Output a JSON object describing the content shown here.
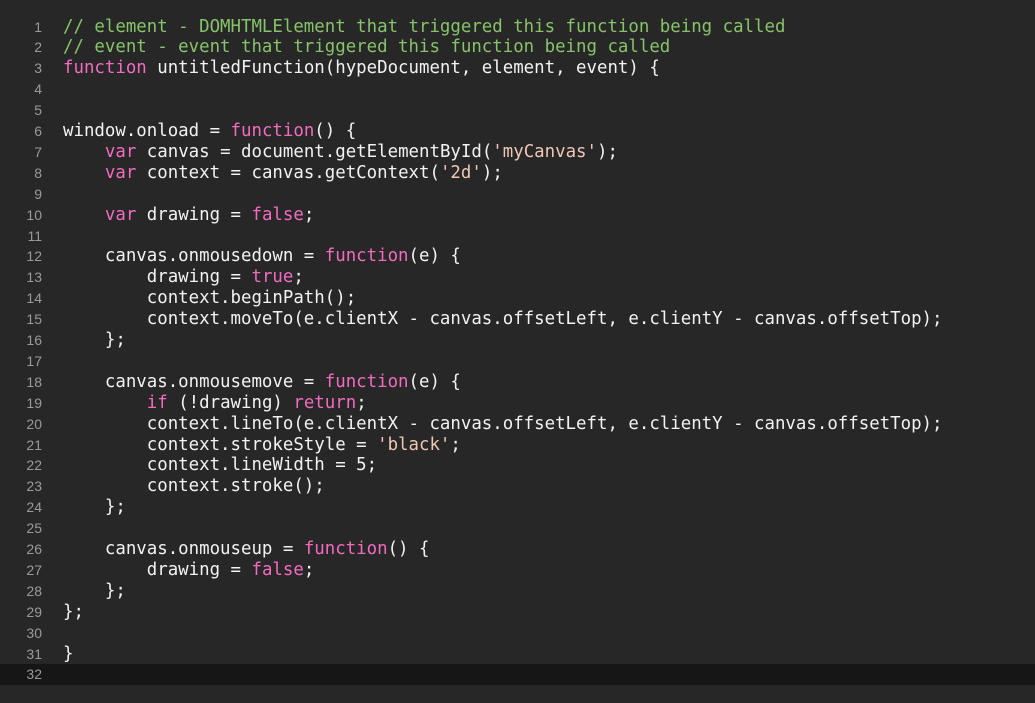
{
  "editor": {
    "colors": {
      "background": "#272727",
      "current_line": "#161616",
      "line_number": "#9a9a9a",
      "plain": "#f2f2f2",
      "comment": "#86c36a",
      "keyword": "#f36bc0",
      "string": "#f0c7b5"
    },
    "current_line": 32,
    "lines": [
      {
        "number": "1",
        "tokens": [
          {
            "t": "comment",
            "v": "// element - DOMHTMLElement that triggered this function being called"
          }
        ]
      },
      {
        "number": "2",
        "tokens": [
          {
            "t": "comment",
            "v": "// event - event that triggered this function being called"
          }
        ]
      },
      {
        "number": "3",
        "tokens": [
          {
            "t": "keyword",
            "v": "function"
          },
          {
            "t": "plain",
            "v": " untitledFunction(hypeDocument, element, event) {"
          }
        ]
      },
      {
        "number": "4",
        "tokens": []
      },
      {
        "number": "5",
        "tokens": []
      },
      {
        "number": "6",
        "tokens": [
          {
            "t": "plain",
            "v": "window.onload = "
          },
          {
            "t": "keyword",
            "v": "function"
          },
          {
            "t": "plain",
            "v": "() {"
          }
        ]
      },
      {
        "number": "7",
        "tokens": [
          {
            "t": "plain",
            "v": "    "
          },
          {
            "t": "keyword",
            "v": "var"
          },
          {
            "t": "plain",
            "v": " canvas = document.getElementById("
          },
          {
            "t": "string",
            "v": "'myCanvas'"
          },
          {
            "t": "plain",
            "v": ");"
          }
        ]
      },
      {
        "number": "8",
        "tokens": [
          {
            "t": "plain",
            "v": "    "
          },
          {
            "t": "keyword",
            "v": "var"
          },
          {
            "t": "plain",
            "v": " context = canvas.getContext("
          },
          {
            "t": "string",
            "v": "'2d'"
          },
          {
            "t": "plain",
            "v": ");"
          }
        ]
      },
      {
        "number": "9",
        "tokens": []
      },
      {
        "number": "10",
        "tokens": [
          {
            "t": "plain",
            "v": "    "
          },
          {
            "t": "keyword",
            "v": "var"
          },
          {
            "t": "plain",
            "v": " drawing = "
          },
          {
            "t": "keyword",
            "v": "false"
          },
          {
            "t": "plain",
            "v": ";"
          }
        ]
      },
      {
        "number": "11",
        "tokens": []
      },
      {
        "number": "12",
        "tokens": [
          {
            "t": "plain",
            "v": "    canvas.onmousedown = "
          },
          {
            "t": "keyword",
            "v": "function"
          },
          {
            "t": "plain",
            "v": "(e) {"
          }
        ]
      },
      {
        "number": "13",
        "tokens": [
          {
            "t": "plain",
            "v": "        drawing = "
          },
          {
            "t": "keyword",
            "v": "true"
          },
          {
            "t": "plain",
            "v": ";"
          }
        ]
      },
      {
        "number": "14",
        "tokens": [
          {
            "t": "plain",
            "v": "        context.beginPath();"
          }
        ]
      },
      {
        "number": "15",
        "tokens": [
          {
            "t": "plain",
            "v": "        context.moveTo(e.clientX - canvas.offsetLeft, e.clientY - canvas.offsetTop);"
          }
        ]
      },
      {
        "number": "16",
        "tokens": [
          {
            "t": "plain",
            "v": "    };"
          }
        ]
      },
      {
        "number": "17",
        "tokens": []
      },
      {
        "number": "18",
        "tokens": [
          {
            "t": "plain",
            "v": "    canvas.onmousemove = "
          },
          {
            "t": "keyword",
            "v": "function"
          },
          {
            "t": "plain",
            "v": "(e) {"
          }
        ]
      },
      {
        "number": "19",
        "tokens": [
          {
            "t": "plain",
            "v": "        "
          },
          {
            "t": "keyword",
            "v": "if"
          },
          {
            "t": "plain",
            "v": " (!drawing) "
          },
          {
            "t": "keyword",
            "v": "return"
          },
          {
            "t": "plain",
            "v": ";"
          }
        ]
      },
      {
        "number": "20",
        "tokens": [
          {
            "t": "plain",
            "v": "        context.lineTo(e.clientX - canvas.offsetLeft, e.clientY - canvas.offsetTop);"
          }
        ]
      },
      {
        "number": "21",
        "tokens": [
          {
            "t": "plain",
            "v": "        context.strokeStyle = "
          },
          {
            "t": "string",
            "v": "'black'"
          },
          {
            "t": "plain",
            "v": ";"
          }
        ]
      },
      {
        "number": "22",
        "tokens": [
          {
            "t": "plain",
            "v": "        context.lineWidth = 5;"
          }
        ]
      },
      {
        "number": "23",
        "tokens": [
          {
            "t": "plain",
            "v": "        context.stroke();"
          }
        ]
      },
      {
        "number": "24",
        "tokens": [
          {
            "t": "plain",
            "v": "    };"
          }
        ]
      },
      {
        "number": "25",
        "tokens": []
      },
      {
        "number": "26",
        "tokens": [
          {
            "t": "plain",
            "v": "    canvas.onmouseup = "
          },
          {
            "t": "keyword",
            "v": "function"
          },
          {
            "t": "plain",
            "v": "() {"
          }
        ]
      },
      {
        "number": "27",
        "tokens": [
          {
            "t": "plain",
            "v": "        drawing = "
          },
          {
            "t": "keyword",
            "v": "false"
          },
          {
            "t": "plain",
            "v": ";"
          }
        ]
      },
      {
        "number": "28",
        "tokens": [
          {
            "t": "plain",
            "v": "    };"
          }
        ]
      },
      {
        "number": "29",
        "tokens": [
          {
            "t": "plain",
            "v": "};"
          }
        ]
      },
      {
        "number": "30",
        "tokens": []
      },
      {
        "number": "31",
        "tokens": [
          {
            "t": "plain",
            "v": "}"
          }
        ]
      },
      {
        "number": "32",
        "tokens": []
      }
    ]
  }
}
